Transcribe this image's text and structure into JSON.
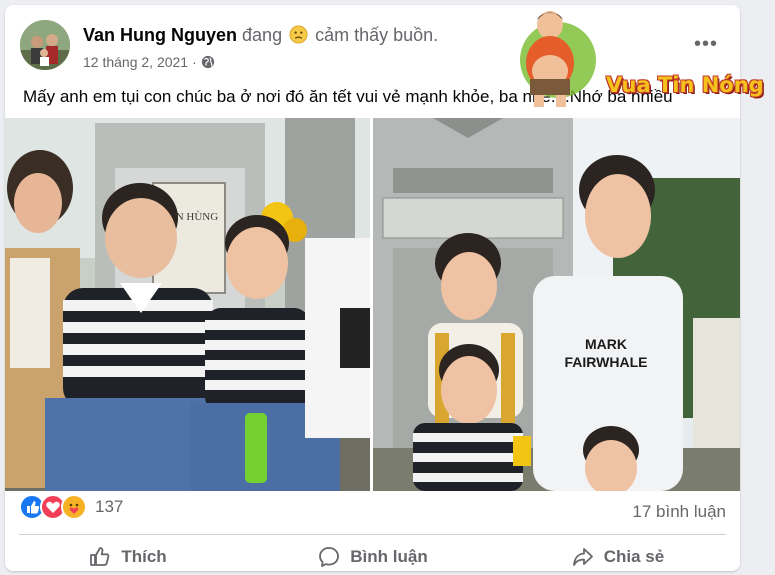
{
  "post": {
    "author": "Van Hung Nguyen",
    "feeling_prefix": "đang",
    "feeling": "cảm thấy buồn.",
    "date": "12 tháng 2, 2021",
    "date_separator": "·",
    "more_label": "•••",
    "text": "Mấy anh em tụi con chúc ba ở nơi đó ăn tết vui vẻ mạnh khỏe, ba nhé....Nhớ ba nhiều"
  },
  "photos": {
    "photo1_plaque": "VĂN HÙNG",
    "photo2_shirt_line1": "MARK",
    "photo2_shirt_line2": "FAIRWHALE"
  },
  "watermark": {
    "text": "Vua Tin Nóng"
  },
  "stats": {
    "reaction_count": "137",
    "comments": "17 bình luận",
    "reaction_types": [
      "like-icon",
      "love-icon",
      "care-icon"
    ],
    "colors": {
      "like": "#1877f2",
      "love": "#f33e58",
      "care": "#f7b125"
    }
  },
  "actions": {
    "like": "Thích",
    "comment": "Bình luận",
    "share": "Chia sẻ"
  }
}
